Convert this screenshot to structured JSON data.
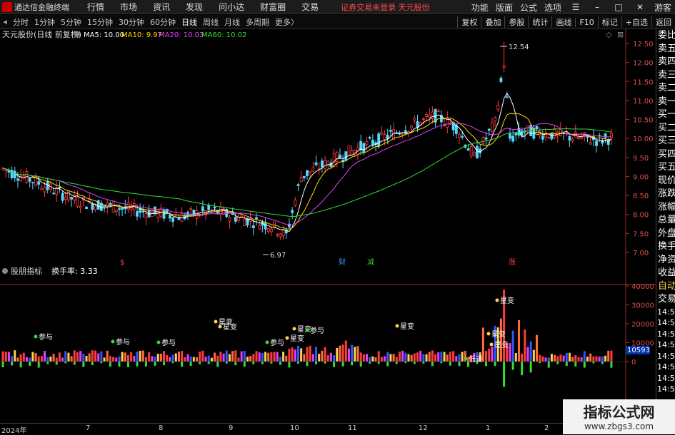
{
  "titlebar": {
    "app_name": "通达信金融终端",
    "menus": [
      "行情",
      "市场",
      "资讯",
      "发现",
      "问小达",
      "财富圈",
      "交易"
    ],
    "notice": "证券交易未登录  天元股份",
    "right_menus": [
      "功能",
      "版面",
      "公式",
      "选项"
    ],
    "guest": "游客"
  },
  "toolbar": {
    "periods": [
      "分时",
      "1分钟",
      "5分钟",
      "15分钟",
      "30分钟",
      "60分钟",
      "日线",
      "周线",
      "月线",
      "多周期",
      "更多〉"
    ],
    "active_period": "日线",
    "right_buttons": [
      "复权",
      "叠加",
      "参股",
      "统计",
      "画线",
      "F10",
      "标记",
      "+自选",
      "返回"
    ]
  },
  "main_chart": {
    "stock_title": "天元股份(日线 前复权)",
    "ma_labels": [
      {
        "text": "MA5: 10.00",
        "color": "#ffffff"
      },
      {
        "text": "MA10: 9.97",
        "color": "#ffd700"
      },
      {
        "text": "MA20: 10.03",
        "color": "#e040fb"
      },
      {
        "text": "MA60: 10.02",
        "color": "#33dd33"
      }
    ],
    "y_ticks": [
      "12.50",
      "12.00",
      "11.50",
      "11.00",
      "10.50",
      "10.00",
      "9.50",
      "9.00",
      "8.50",
      "8.00",
      "7.50",
      "7.00"
    ],
    "high_label": "12.54",
    "low_label": "6.97",
    "markers": [
      {
        "text": "$",
        "color": "#ff4444"
      },
      {
        "text": "财",
        "color": "#3399ff"
      },
      {
        "text": "减",
        "color": "#33cc33"
      },
      {
        "text": "涨",
        "color": "#ff4444"
      }
    ]
  },
  "sub_chart": {
    "title": "股朋指标",
    "metric": "换手率: 3.33",
    "y_ticks": [
      "40000",
      "30000",
      "20000",
      "10000",
      "0"
    ],
    "current_value": "10593",
    "annotations": [
      "参与",
      "参与",
      "参与",
      "星变",
      "星变",
      "参与",
      "星变",
      "星变",
      "参与",
      "星变",
      "星变",
      "低进",
      "星变",
      "星变"
    ]
  },
  "x_axis": {
    "labels": [
      "2024年",
      "7",
      "8",
      "9",
      "10",
      "11",
      "12",
      "1",
      "2"
    ]
  },
  "right_panel": {
    "quote_items": [
      "委比",
      "卖五",
      "卖四",
      "卖三",
      "卖二",
      "卖一",
      "买一",
      "买二",
      "买三",
      "买四",
      "买五",
      "现价",
      "涨跌",
      "涨幅",
      "总量",
      "外盘",
      "换手",
      "净资",
      "收益"
    ],
    "trade_header": "自动",
    "trade_title": "交易",
    "times": [
      "14:5",
      "14:5",
      "14:5",
      "14:5",
      "14:5",
      "14:5",
      "14:5",
      "14:5"
    ]
  },
  "watermark": {
    "line1": "指标公式网",
    "line2": "www.zbgs3.com"
  },
  "colors": {
    "up": "#ff3b3b",
    "down": "#54d8ff",
    "ma5": "#ffffff",
    "ma10": "#ffd700",
    "ma20": "#e040fb",
    "ma60": "#33dd33"
  }
}
